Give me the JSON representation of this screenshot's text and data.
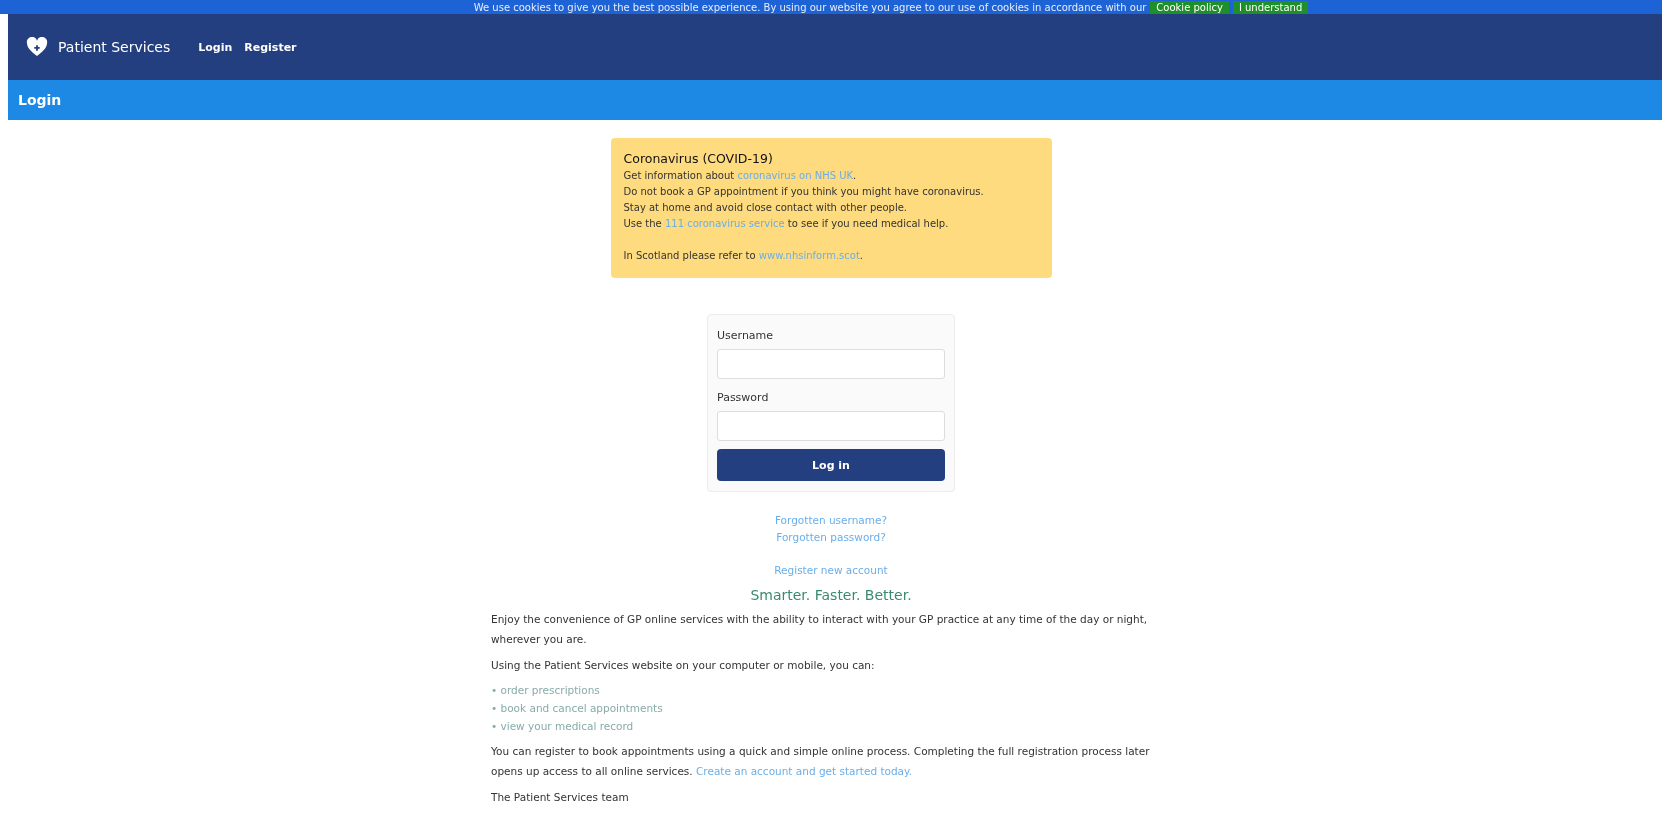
{
  "cookie_banner": {
    "text": "We use cookies to give you the best possible experience. By using our website you agree to our use of cookies in accordance with our",
    "buttons": [
      "Cookie policy",
      "I understand"
    ]
  },
  "navbar": {
    "brand": "Patient Services",
    "links": [
      "Login",
      "Register"
    ]
  },
  "page_title": "Login",
  "notice": {
    "title": "Coronavirus (COVID-19)",
    "lines": [
      {
        "before": "Get information about ",
        "link": "coronavirus on NHS UK",
        "after": "."
      },
      {
        "before": "Do not book a GP appointment if you think you might have coronavirus."
      },
      {
        "before": "Stay at home and avoid close contact with other people."
      },
      {
        "before": "Use the ",
        "link": "111 coronavirus service",
        "after": " to see if you need medical help."
      }
    ],
    "footnote": {
      "before": "In Scotland please refer to ",
      "link": "www.nhsinform.scot",
      "after": "."
    }
  },
  "login_form": {
    "fields": [
      {
        "label": "Username"
      },
      {
        "label": "Password"
      }
    ],
    "submit": "Log in"
  },
  "recovery_links": [
    "Forgotten username?",
    "Forgotten password?"
  ],
  "register_link": "Register new account",
  "tagline": "Smarter. Faster. Better.",
  "intro": [
    "Enjoy the convenience of GP online services with the ability to interact with your GP practice at any time of the day or night, wherever you are.",
    "Using the Patient Services website on your computer or mobile, you can:"
  ],
  "features": [
    "• order prescriptions",
    "• book and cancel appointments",
    "• view your medical record"
  ],
  "register_text": {
    "text": "You can register to book appointments using a quick and simple online process. Completing the full registration process later opens up access to all online services.",
    "link": "Create an account and get started today."
  },
  "signoff": "The Patient Services team"
}
